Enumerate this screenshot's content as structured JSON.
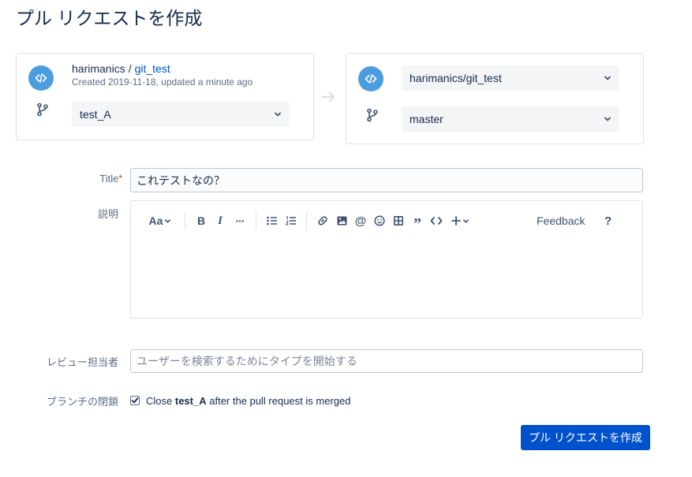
{
  "page": {
    "title": "プル リクエストを作成"
  },
  "source": {
    "owner": "harimanics",
    "separator": "/",
    "repo": "git_test",
    "meta": "Created 2019-11-18, updated a minute ago",
    "branch": "test_A"
  },
  "destination": {
    "repo": "harimanics/git_test",
    "branch": "master"
  },
  "form": {
    "title_label": "Title",
    "required_mark": "*",
    "title_value": "これテストなの？",
    "description_label": "説明",
    "reviewers_label": "レビュー担当者",
    "reviewers_placeholder": "ユーザーを検索するためにタイプを開始する",
    "close_branch_label": "ブランチの閉鎖",
    "close_text_before": "Close",
    "close_branch_name": "test_A",
    "close_text_after": "after the pull request is merged",
    "close_checked": true
  },
  "editor_toolbar": {
    "text_style": "Aa",
    "bold": "B",
    "italic": "I",
    "more": "···",
    "feedback": "Feedback",
    "help": "?",
    "icons": [
      "text-style-icon",
      "bold-icon",
      "italic-icon",
      "more-formatting-icon",
      "bullet-list-icon",
      "numbered-list-icon",
      "link-icon",
      "image-icon",
      "mention-icon",
      "emoji-icon",
      "table-icon",
      "quote-icon",
      "code-icon",
      "insert-icon"
    ]
  },
  "actions": {
    "submit": "プル リクエストを作成"
  },
  "colors": {
    "accent": "#0052cc",
    "avatar": "#4c9de0",
    "required": "#de350b"
  }
}
